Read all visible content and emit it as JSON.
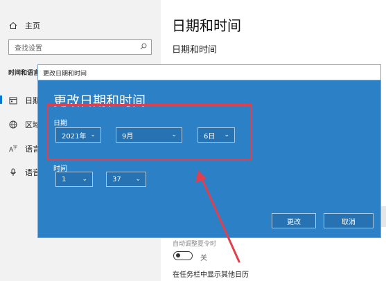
{
  "sidebar": {
    "home_label": "主页",
    "search_placeholder": "查找设置",
    "section_label": "时间和语言",
    "items": [
      {
        "label": "日期",
        "icon": "calendar-icon"
      },
      {
        "label": "区域",
        "icon": "globe-icon"
      },
      {
        "label": "语言",
        "icon": "language-icon"
      },
      {
        "label": "语音",
        "icon": "microphone-icon"
      }
    ]
  },
  "main": {
    "title": "日期和时间",
    "subtitle": "日期和时间",
    "toggle_label": "自动调整夏令时",
    "toggle_state": "关",
    "calendar_label": "在任务栏中显示其他日历"
  },
  "dialog": {
    "window_title": "更改日期和时间",
    "heading": "更改日期和时间",
    "date_label": "日期",
    "year": "2021年",
    "month": "9月",
    "day": "6日",
    "time_label": "时间",
    "hour": "1",
    "minute": "37",
    "change_button": "更改",
    "cancel_button": "取消"
  },
  "colors": {
    "dialog_bg": "#2b80c6",
    "annotation": "#e0404e",
    "sidebar_bg": "#f2f2f2"
  }
}
